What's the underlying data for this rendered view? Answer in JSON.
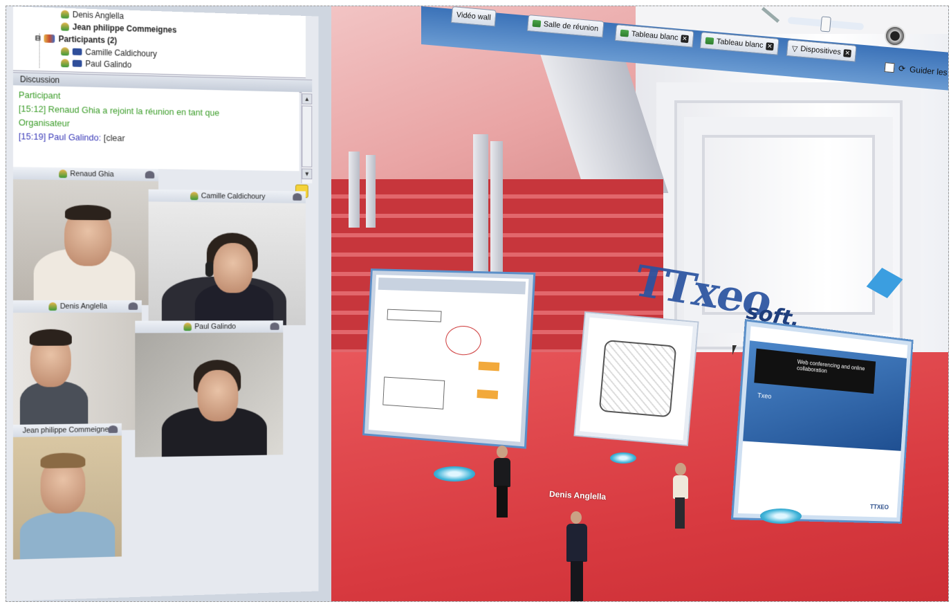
{
  "participants_tree": {
    "rows": [
      {
        "label": "Denis Anglella",
        "bold": false
      },
      {
        "label": "Jean philippe Commeignes",
        "bold": true
      },
      {
        "label": "Participants (2)",
        "bold": true
      },
      {
        "label": "Camille Caldichoury",
        "bold": false
      },
      {
        "label": "Paul Galindo",
        "bold": false
      }
    ]
  },
  "discussion": {
    "title": "Discussion",
    "lines": [
      {
        "text": "Participant",
        "color": "green"
      },
      {
        "text": "[15:12] Renaud Ghia a rejoint la réunion en tant que",
        "color": "green"
      },
      {
        "text": "Organisateur",
        "color": "green"
      },
      {
        "text": "[15:19] Paul Galindo: ",
        "color": "blue",
        "suffix": "[clear"
      }
    ]
  },
  "videos": [
    {
      "name": "Renaud Ghia"
    },
    {
      "name": "Camille Caldichoury"
    },
    {
      "name": "Denis Anglella"
    },
    {
      "name": "Paul Galindo"
    },
    {
      "name": "Jean philippe Commeignes"
    }
  ],
  "toolbar": {
    "tabs": [
      {
        "label": "Vidéo wall",
        "closable": false
      },
      {
        "label": "Salle de réunion",
        "closable": false
      },
      {
        "label": "Tableau blanc",
        "closable": true
      },
      {
        "label": "Tableau blanc",
        "closable": true
      },
      {
        "label": "Dispositives",
        "closable": true
      }
    ],
    "guide_label": "Guider les"
  },
  "scene": {
    "logo_main": "TTxeo",
    "logo_sub": "soft.",
    "avatar_label": "Denis Anglella",
    "slide": {
      "heading": "Web conferencing and online collaboration",
      "title": "Txeo",
      "footer": "TTXEO"
    }
  },
  "colors": {
    "accent_blue": "#3b72b8",
    "chat_green": "#3c9d2a",
    "chat_blue": "#3a3ab8",
    "floor_red": "#d83a40"
  }
}
